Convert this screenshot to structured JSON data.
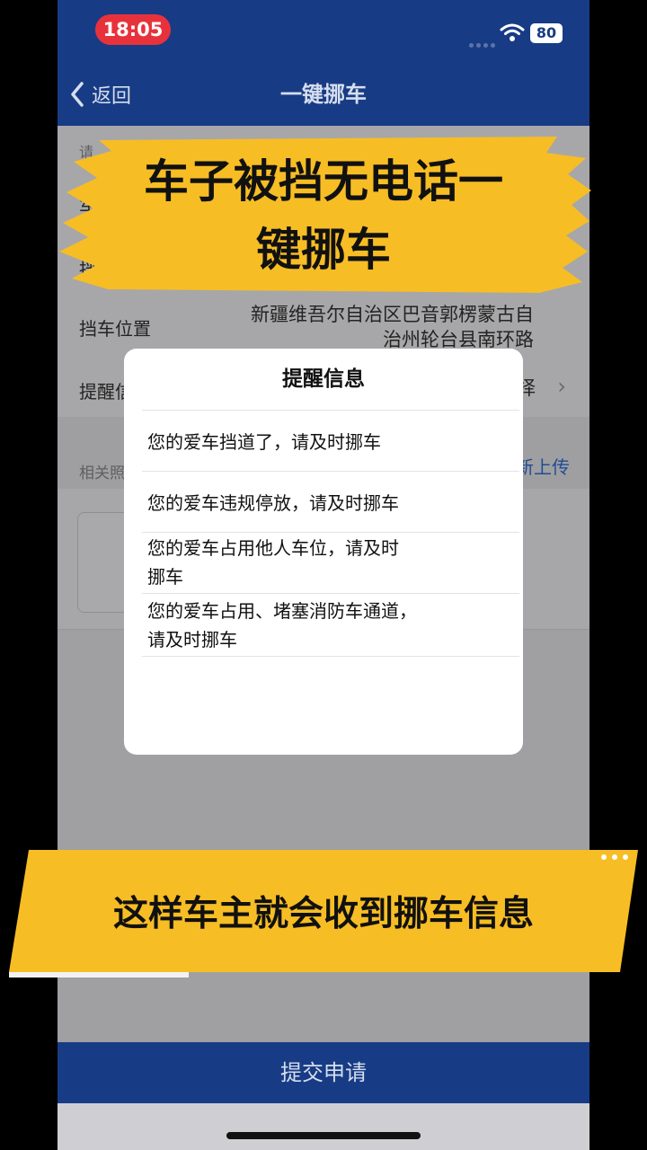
{
  "status_bar": {
    "time": "18:05",
    "battery": "80"
  },
  "nav": {
    "back_label": "返回",
    "title": "一键挪车"
  },
  "form": {
    "row1_label": "请",
    "row2_label": "车",
    "row3_label": "挡",
    "location_label": "挡车位置",
    "location_value": [
      "新疆维吾尔自治区巴音郭楞蒙古自",
      "治州轮台县南环路"
    ],
    "reminder_label": "提醒信",
    "reminder_value": "择",
    "photos_hint": "相关照",
    "upload_label": "新上传"
  },
  "modal": {
    "title": "提醒信息",
    "options": [
      [
        "您的爱车挡道了，请及时挪车"
      ],
      [
        "您的爱车违规停放，请及时挪车"
      ],
      [
        "您的爱车占用他人车位，请及时",
        "挪车"
      ],
      [
        "您的爱车占用、堵塞消防车通道，",
        "请及时挪车"
      ]
    ]
  },
  "overlay": {
    "top_banner": [
      "车子被挡无电话一",
      "键挪车"
    ],
    "bottom_banner": "这样车主就会收到挪车信息",
    "accent_color": "#f7bd24"
  },
  "submit_label": "提交申请"
}
